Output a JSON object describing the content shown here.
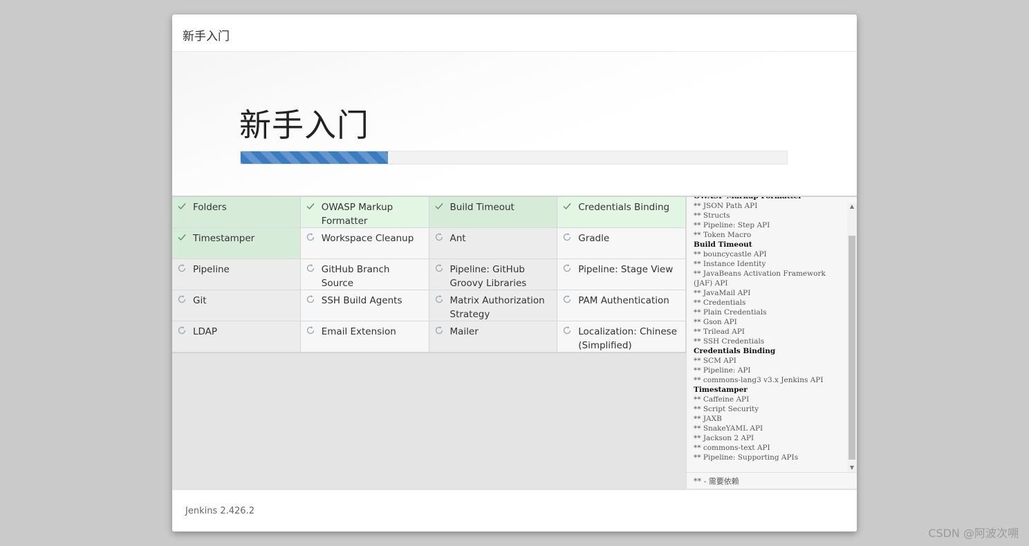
{
  "header": {
    "title": "新手入门"
  },
  "hero": {
    "title": "新手入门",
    "progress": 0.27
  },
  "plugins": [
    {
      "name": "Folders",
      "status": "success",
      "shade": "normal"
    },
    {
      "name": "OWASP Markup Formatter",
      "status": "success",
      "shade": "light"
    },
    {
      "name": "Build Timeout",
      "status": "success",
      "shade": "normal"
    },
    {
      "name": "Credentials Binding",
      "status": "success",
      "shade": "light"
    },
    {
      "name": "Timestamper",
      "status": "success",
      "shade": "normal"
    },
    {
      "name": "Workspace Cleanup",
      "status": "pending",
      "shade": "light"
    },
    {
      "name": "Ant",
      "status": "pending",
      "shade": "normal"
    },
    {
      "name": "Gradle",
      "status": "pending",
      "shade": "light"
    },
    {
      "name": "Pipeline",
      "status": "pending",
      "shade": "normal"
    },
    {
      "name": "GitHub Branch Source",
      "status": "pending",
      "shade": "light"
    },
    {
      "name": "Pipeline: GitHub Groovy Libraries",
      "status": "pending",
      "shade": "normal"
    },
    {
      "name": "Pipeline: Stage View",
      "status": "pending",
      "shade": "light"
    },
    {
      "name": "Git",
      "status": "pending",
      "shade": "normal"
    },
    {
      "name": "SSH Build Agents",
      "status": "pending",
      "shade": "light"
    },
    {
      "name": "Matrix Authorization Strategy",
      "status": "pending",
      "shade": "normal"
    },
    {
      "name": "PAM Authentication",
      "status": "pending",
      "shade": "light"
    },
    {
      "name": "LDAP",
      "status": "pending",
      "shade": "normal"
    },
    {
      "name": "Email Extension",
      "status": "pending",
      "shade": "light"
    },
    {
      "name": "Mailer",
      "status": "pending",
      "shade": "normal"
    },
    {
      "name": "Localization: Chinese (Simplified)",
      "status": "pending",
      "shade": "light"
    }
  ],
  "log": {
    "lines": [
      {
        "text": "OWASP Markup Formatter",
        "kind": "plugin-head"
      },
      {
        "text": "** JSON Path API",
        "kind": "dep"
      },
      {
        "text": "** Structs",
        "kind": "dep"
      },
      {
        "text": "** Pipeline: Step API",
        "kind": "dep"
      },
      {
        "text": "** Token Macro",
        "kind": "dep"
      },
      {
        "text": "Build Timeout",
        "kind": "plugin-head"
      },
      {
        "text": "** bouncycastle API",
        "kind": "dep"
      },
      {
        "text": "** Instance Identity",
        "kind": "dep"
      },
      {
        "text": "** JavaBeans Activation Framework",
        "kind": "dep"
      },
      {
        "text": "(JAF) API",
        "kind": "dep"
      },
      {
        "text": "** JavaMail API",
        "kind": "dep"
      },
      {
        "text": "** Credentials",
        "kind": "dep"
      },
      {
        "text": "** Plain Credentials",
        "kind": "dep"
      },
      {
        "text": "** Gson API",
        "kind": "dep"
      },
      {
        "text": "** Trilead API",
        "kind": "dep"
      },
      {
        "text": "** SSH Credentials",
        "kind": "dep"
      },
      {
        "text": "Credentials Binding",
        "kind": "plugin-head"
      },
      {
        "text": "** SCM API",
        "kind": "dep"
      },
      {
        "text": "** Pipeline: API",
        "kind": "dep"
      },
      {
        "text": "** commons-lang3 v3.x Jenkins API",
        "kind": "dep"
      },
      {
        "text": "Timestamper",
        "kind": "plugin-head"
      },
      {
        "text": "** Caffeine API",
        "kind": "dep"
      },
      {
        "text": "** Script Security",
        "kind": "dep"
      },
      {
        "text": "** JAXB",
        "kind": "dep"
      },
      {
        "text": "** SnakeYAML API",
        "kind": "dep"
      },
      {
        "text": "** Jackson 2 API",
        "kind": "dep"
      },
      {
        "text": "** commons-text API",
        "kind": "dep"
      },
      {
        "text": "** Pipeline: Supporting APIs",
        "kind": "dep"
      }
    ],
    "legend": "** - 需要依赖"
  },
  "footer": {
    "version": "Jenkins 2.426.2"
  },
  "watermark": "CSDN @阿波次嗍",
  "colors": {
    "progress": "#3b7cc0",
    "success_bg": "#d7ebd9",
    "pending_bg": "#ececec"
  }
}
